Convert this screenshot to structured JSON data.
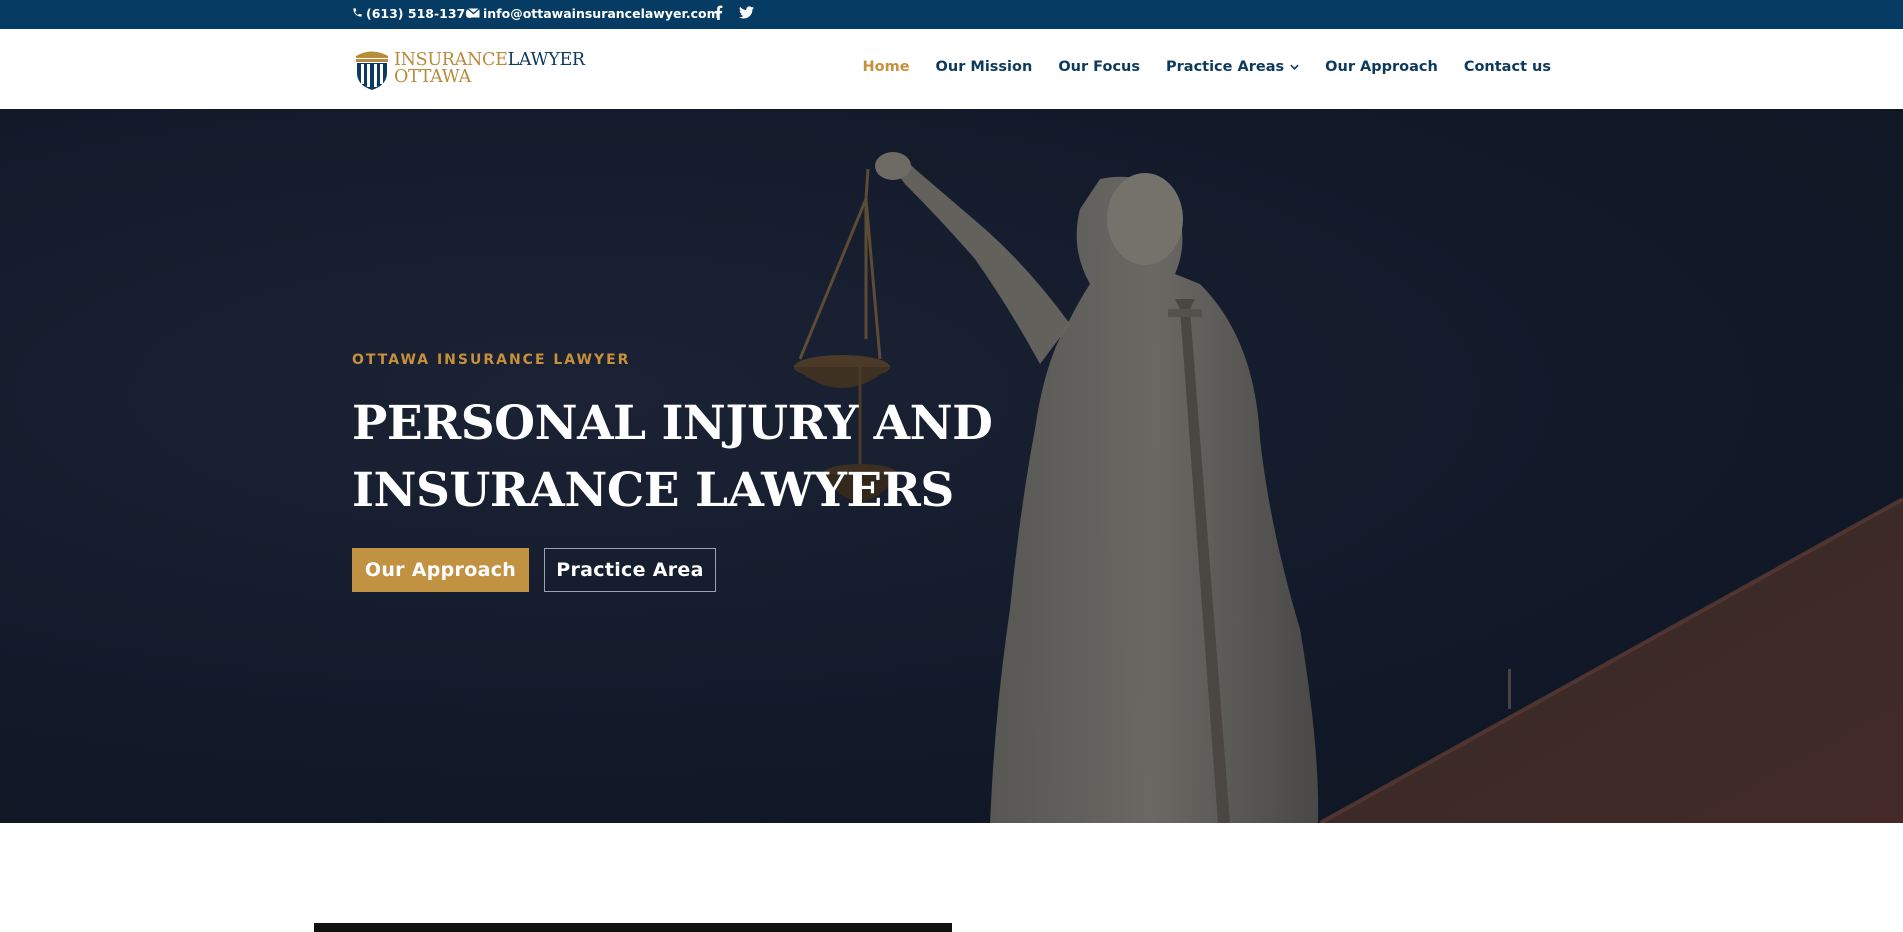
{
  "topbar": {
    "phone": "(613) 518-1370",
    "email": "info@ottawainsurancelawyer.com",
    "social": [
      "facebook-icon",
      "twitter-icon"
    ]
  },
  "logo": {
    "word1": "INSURANCE",
    "word2": "LAWYER",
    "word3": "OTTAWA"
  },
  "nav": {
    "items": [
      {
        "label": "Home",
        "active": true
      },
      {
        "label": "Our Mission"
      },
      {
        "label": "Our Focus"
      },
      {
        "label": "Practice Areas",
        "has_dropdown": true
      },
      {
        "label": "Our Approach"
      },
      {
        "label": "Contact us"
      }
    ]
  },
  "hero": {
    "eyebrow": "OTTAWA INSURANCE LAWYER",
    "headline_line1": "PERSONAL INJURY AND",
    "headline_line2": "INSURANCE LAWYERS",
    "primary_button": "Our Approach",
    "secondary_button": "Practice Area"
  },
  "colors": {
    "topbar": "#063c63",
    "accent_gold": "#c29243",
    "nav_text": "#0b3a5e",
    "hero_bg": "#121a2a"
  }
}
